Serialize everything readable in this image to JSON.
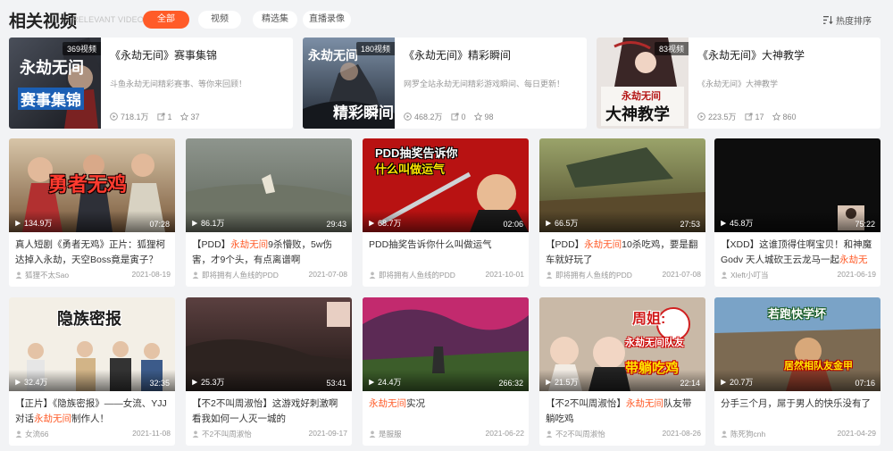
{
  "header": {
    "title": "相关视频",
    "subtitle": "RELEVANT VIDEO",
    "tabs": [
      {
        "label": "全部",
        "active": true
      },
      {
        "label": "视频",
        "active": false
      },
      {
        "label": "精选集",
        "active": false
      },
      {
        "label": "直播录像",
        "active": false
      }
    ],
    "sort_label": "热度排序"
  },
  "collections": [
    {
      "count": "369视频",
      "title": "《永劫无间》赛事集锦",
      "desc": "斗鱼永劫无间精彩赛事、等你来回顾！",
      "views": "718.1万",
      "shares": "1",
      "stars": "37",
      "thumb_text": "赛事集锦",
      "thumb_text2": "永劫无间"
    },
    {
      "count": "180视频",
      "title": "《永劫无间》精彩瞬间",
      "desc": "网罗全站永劫无间精彩游戏瞬间、每日更新！",
      "views": "468.2万",
      "shares": "0",
      "stars": "98",
      "thumb_text": "精彩瞬间",
      "thumb_text2": "永劫无间"
    },
    {
      "count": "83视频",
      "title": "《永劫无间》大神教学",
      "desc": "《永劫无间》大神教学",
      "views": "223.5万",
      "shares": "17",
      "stars": "860",
      "thumb_text": "大神教学",
      "thumb_text2": "永劫无间"
    }
  ],
  "videos": [
    {
      "views": "134.9万",
      "duration": "07:28",
      "title_pre": "真人短剧《勇者无鸡》正片：狐狸柯达掉入永劫，天空Boss竟是寅子？",
      "title_hl": "",
      "title_post": "",
      "author": "狐狸不太Sao",
      "date": "2021-08-19",
      "banner": "勇者无鸡",
      "banner_color": "#ff3b2f"
    },
    {
      "views": "86.1万",
      "duration": "29:43",
      "title_pre": "【PDD】",
      "title_hl": "永劫无间",
      "title_post": "9杀懵败，5w伤害，才9个头，有点离谱啊",
      "author": "即将拥有人鱼线的PDD",
      "date": "2021-07-08",
      "banner": "",
      "banner_color": ""
    },
    {
      "views": "68.7万",
      "duration": "02:06",
      "title_pre": "PDD抽奖告诉你什么叫做运气",
      "title_hl": "",
      "title_post": "",
      "author": "即将拥有人鱼线的PDD",
      "date": "2021-10-01",
      "banner": "PDD抽奖告诉你",
      "banner2": "什么叫做运气",
      "banner_color": "#ffffff"
    },
    {
      "views": "66.5万",
      "duration": "27:53",
      "title_pre": "【PDD】",
      "title_hl": "永劫无间",
      "title_post": "10杀吃鸡，要是翻车就好玩了",
      "author": "即将拥有人鱼线的PDD",
      "date": "2021-07-08",
      "banner": "",
      "banner_color": ""
    },
    {
      "views": "45.8万",
      "duration": "75:22",
      "title_pre": "【XDD】这谁顶得住啊宝贝！和神魔Godv 天人城砍王云龙马一起",
      "title_hl": "永劫无",
      "title_post": "",
      "author": "Xleft小叮当",
      "date": "2021-06-19",
      "banner": "",
      "banner_color": ""
    },
    {
      "views": "32.4万",
      "duration": "32:35",
      "title_pre": "【正片】《隐族密报》——女流、YJJ对话",
      "title_hl": "永劫无间",
      "title_post": "制作人！",
      "author": "女流66",
      "date": "2021-11-08",
      "banner": "隐族密报",
      "banner_color": "#222222"
    },
    {
      "views": "25.3万",
      "duration": "53:41",
      "title_pre": "【不2不叫周淑怡】这游戏好刺激啊 看我如何一人灭一城的",
      "title_hl": "",
      "title_post": "",
      "author": "不2不叫周淑怡",
      "date": "2021-09-17",
      "banner": "",
      "banner_color": ""
    },
    {
      "views": "24.4万",
      "duration": "266:32",
      "title_pre": "",
      "title_hl": "永劫无间",
      "title_post": "实况",
      "author": "是服服",
      "date": "2021-06-22",
      "banner": "",
      "banner_color": ""
    },
    {
      "views": "21.5万",
      "duration": "22:14",
      "title_pre": "【不2不叫周淑怡】",
      "title_hl": "永劫无间",
      "title_post": "队友带躺吃鸡",
      "author": "不2不叫周淑怡",
      "date": "2021-08-26",
      "banner": "周姐:",
      "banner2": "永劫无间队友",
      "banner3": "带躺吃鸡",
      "banner_color": "#ffffff"
    },
    {
      "views": "20.7万",
      "duration": "07:16",
      "title_pre": "分手三个月，屌于男人的快乐没有了",
      "title_hl": "",
      "title_post": "",
      "author": "陈死狗cnh",
      "date": "2021-04-29",
      "banner": "若跑快学坏",
      "banner2": "居然相队友金甲",
      "banner_color": "#ffffff"
    }
  ],
  "colors": {
    "accent": "#ff5b28",
    "bg": "#f2f3f5",
    "card": "#ffffff",
    "muted": "#999999"
  },
  "icons": {
    "views": "play-icon",
    "share": "share-icon",
    "star": "star-icon",
    "author": "user-icon",
    "sort": "sort-icon"
  }
}
